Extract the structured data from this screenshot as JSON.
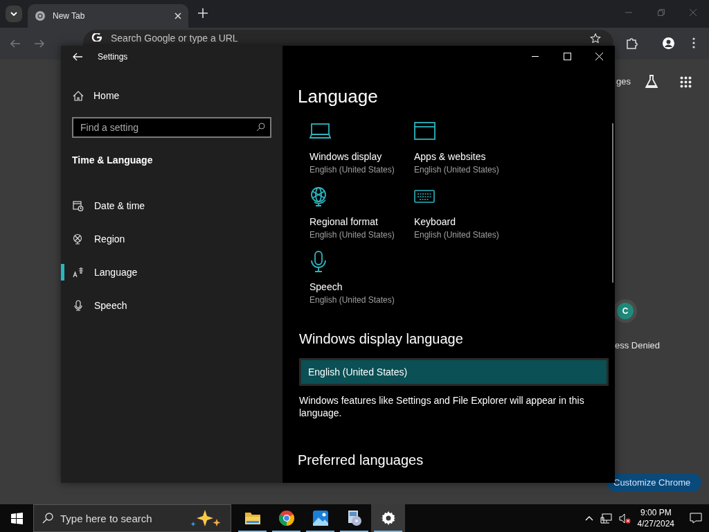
{
  "browser": {
    "tabs": [
      {
        "title": "New Tab",
        "selected": true
      }
    ],
    "address_placeholder": "Search Google or type a URL",
    "page": {
      "header_link": "ges",
      "shortcut": {
        "letter": "C",
        "label": "ess Denied"
      },
      "customize_button": "Customize Chrome"
    }
  },
  "settings": {
    "title": "Settings",
    "sidebar": {
      "home": "Home",
      "search_placeholder": "Find a setting",
      "section": "Time & Language",
      "items": [
        {
          "label": "Date & time",
          "kind": "calendar",
          "selected": false
        },
        {
          "label": "Region",
          "kind": "globe",
          "selected": false
        },
        {
          "label": "Language",
          "kind": "language",
          "selected": true
        },
        {
          "label": "Speech",
          "kind": "microphone",
          "selected": false
        }
      ]
    },
    "main": {
      "heading": "Language",
      "tiles": [
        {
          "kind": "laptop",
          "title": "Windows display",
          "subtitle": "English (United States)"
        },
        {
          "kind": "window",
          "title": "Apps & websites",
          "subtitle": "English (United States)"
        },
        {
          "kind": "globe",
          "title": "Regional format",
          "subtitle": "English (United States)"
        },
        {
          "kind": "keyboard",
          "title": "Keyboard",
          "subtitle": "English (United States)"
        },
        {
          "kind": "microphone",
          "title": "Speech",
          "subtitle": "English (United States)"
        }
      ],
      "display_language": {
        "heading": "Windows display language",
        "value": "English (United States)",
        "description": "Windows features like Settings and File Explorer will appear in this language."
      },
      "preferred_heading": "Preferred languages"
    }
  },
  "taskbar": {
    "search_placeholder": "Type here to search",
    "apps": [
      {
        "kind": "folder",
        "active": false
      },
      {
        "kind": "browser",
        "active": false
      },
      {
        "kind": "photos",
        "active": false
      },
      {
        "kind": "media",
        "active": false
      },
      {
        "kind": "settings",
        "active": true
      }
    ],
    "time": "9:00 PM",
    "date": "4/27/2024"
  }
}
